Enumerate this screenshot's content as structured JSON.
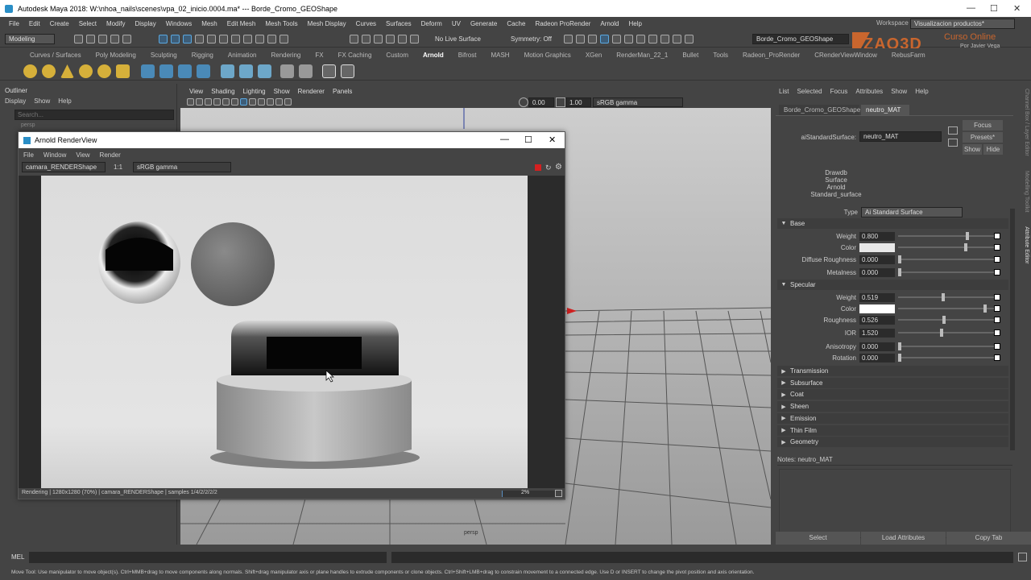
{
  "app": {
    "title": "Autodesk Maya 2018: W:\\nhoa_nails\\scenes\\vpa_02_inicio.0004.ma*  ---  Borde_Cromo_GEOShape"
  },
  "menu": [
    "File",
    "Edit",
    "Create",
    "Select",
    "Modify",
    "Display",
    "Windows",
    "Mesh",
    "Edit Mesh",
    "Mesh Tools",
    "Mesh Display",
    "Curves",
    "Surfaces",
    "Deform",
    "UV",
    "Generate",
    "Cache",
    "Radeon ProRender",
    "Arnold",
    "Help"
  ],
  "workspace": {
    "label": "Workspace :",
    "value": "Visualizacion productos*"
  },
  "statusline": {
    "mode": "Modeling",
    "live_surface": "No Live Surface",
    "symmetry": "Symmetry: Off",
    "object_name": "Borde_Cromo_GEOShape"
  },
  "watermark": {
    "logo": "ZAO3D",
    "course": "Curso Online",
    "author": "Por Javier Vega"
  },
  "shelf_tabs": [
    "Curves / Surfaces",
    "Poly Modeling",
    "Sculpting",
    "Rigging",
    "Animation",
    "Rendering",
    "FX",
    "FX Caching",
    "Custom",
    "Arnold",
    "Bifrost",
    "MASH",
    "Motion Graphics",
    "XGen",
    "RenderMan_22_1",
    "Bullet",
    "Tools",
    "Radeon_ProRender",
    "CRenderViewWindow",
    "RebusFarm"
  ],
  "shelf_active": "Arnold",
  "outliner": {
    "title": "Outliner",
    "menu": [
      "Display",
      "Show",
      "Help"
    ],
    "search_placeholder": "Search...",
    "item": "persp"
  },
  "viewport": {
    "menu": [
      "View",
      "Shading",
      "Lighting",
      "Show",
      "Renderer",
      "Panels"
    ],
    "exposure": "0.00",
    "gamma": "1.00",
    "colorspace": "sRGB gamma",
    "camera_label": "persp"
  },
  "renderview": {
    "title": "Arnold RenderView",
    "menu": [
      "File",
      "Window",
      "View",
      "Render"
    ],
    "camera": "camara_RENDERShape",
    "ratio": "1:1",
    "colorspace": "sRGB gamma",
    "status": "Rendering | 1280x1280 (70%) | camara_RENDERShape | samples 1/4/2/2/2/2",
    "progress": "2%"
  },
  "attribute_editor": {
    "menu": [
      "List",
      "Selected",
      "Focus",
      "Attributes",
      "Show",
      "Help"
    ],
    "tabs": [
      "Borde_Cromo_GEOShape",
      "neutro_MAT"
    ],
    "node_label": "aiStandardSurface:",
    "node_value": "neutro_MAT",
    "buttons": {
      "focus": "Focus",
      "presets": "Presets*",
      "show": "Show",
      "hide": "Hide"
    },
    "swatch_lines": [
      "Drawdb",
      "Surface",
      "Arnold",
      "Standard_surface"
    ],
    "type_label": "Type",
    "type_value": "Ai Standard Surface",
    "base": {
      "title": "Base",
      "weight": "0.800",
      "color_label": "Color",
      "diffuse_roughness": "0.000",
      "metalness": "0.000"
    },
    "specular": {
      "title": "Specular",
      "weight": "0.519",
      "color_label": "Color",
      "roughness": "0.526",
      "ior": "1.520",
      "anisotropy": "0.000",
      "rotation": "0.000"
    },
    "labels": {
      "weight": "Weight",
      "diffuse_roughness": "Diffuse Roughness",
      "metalness": "Metalness",
      "roughness": "Roughness",
      "ior": "IOR",
      "anisotropy": "Anisotropy",
      "rotation": "Rotation"
    },
    "sections": [
      "Transmission",
      "Subsurface",
      "Coat",
      "Sheen",
      "Emission",
      "Thin Film",
      "Geometry"
    ],
    "notes": "Notes:  neutro_MAT",
    "bottom_buttons": [
      "Select",
      "Load Attributes",
      "Copy Tab"
    ]
  },
  "side_tabs": [
    "Channel Box / Layer Editor",
    "Modelling Toolkit",
    "Attribute Editor"
  ],
  "command": {
    "label": "MEL"
  },
  "help_line": "Move Tool: Use manipulator to move object(s). Ctrl+MMB+drag to move components along normals. Shift+drag manipulator axis or plane handles to extrude components or clone objects. Ctrl+Shift+LMB+drag to constrain movement to a connected edge. Use D or INSERT to change the pivot position and axis orientation."
}
